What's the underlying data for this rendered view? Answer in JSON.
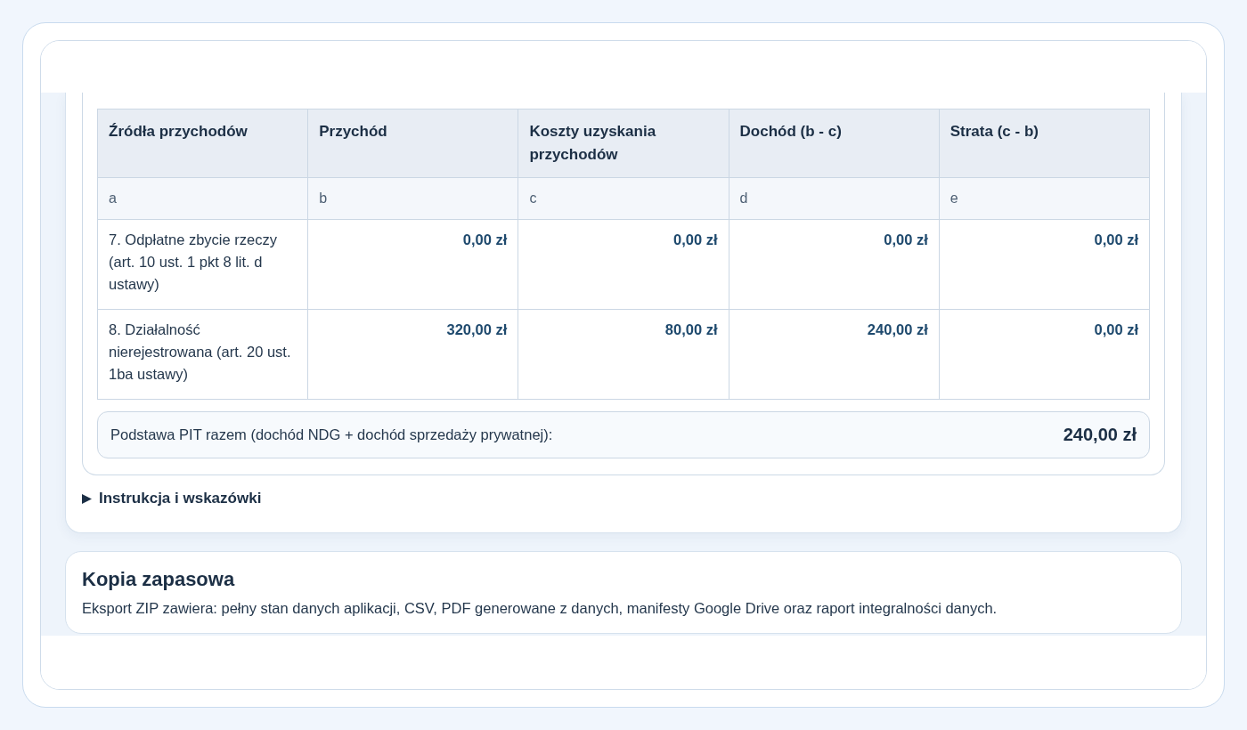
{
  "table": {
    "columns": [
      "Źródła przychodów",
      "Przychód",
      "Koszty uzyskania przychodów",
      "Dochód (b - c)",
      "Strata (c - b)"
    ],
    "column_letters": [
      "a",
      "b",
      "c",
      "d",
      "e"
    ],
    "rows": [
      {
        "source": "7. Odpłatne zbycie rzeczy (art. 10 ust. 1 pkt 8 lit. d ustawy)",
        "values": [
          "0,00 zł",
          "0,00 zł",
          "0,00 zł",
          "0,00 zł"
        ]
      },
      {
        "source": "8. Działalność nierejestrowana (art. 20 ust. 1ba ustawy)",
        "values": [
          "320,00 zł",
          "80,00 zł",
          "240,00 zł",
          "0,00 zł"
        ]
      }
    ]
  },
  "summary": {
    "label": "Podstawa PIT razem (dochód NDG + dochód sprzedaży prywatnej):",
    "value": "240,00 zł"
  },
  "instructions": {
    "label": "Instrukcja i wskazówki",
    "expanded": false
  },
  "backup": {
    "title": "Kopia zapasowa",
    "description": "Eksport ZIP zawiera: pełny stan danych aplikacji, CSV, PDF generowane z danych, manifesty Google Drive oraz raport integralności danych."
  }
}
